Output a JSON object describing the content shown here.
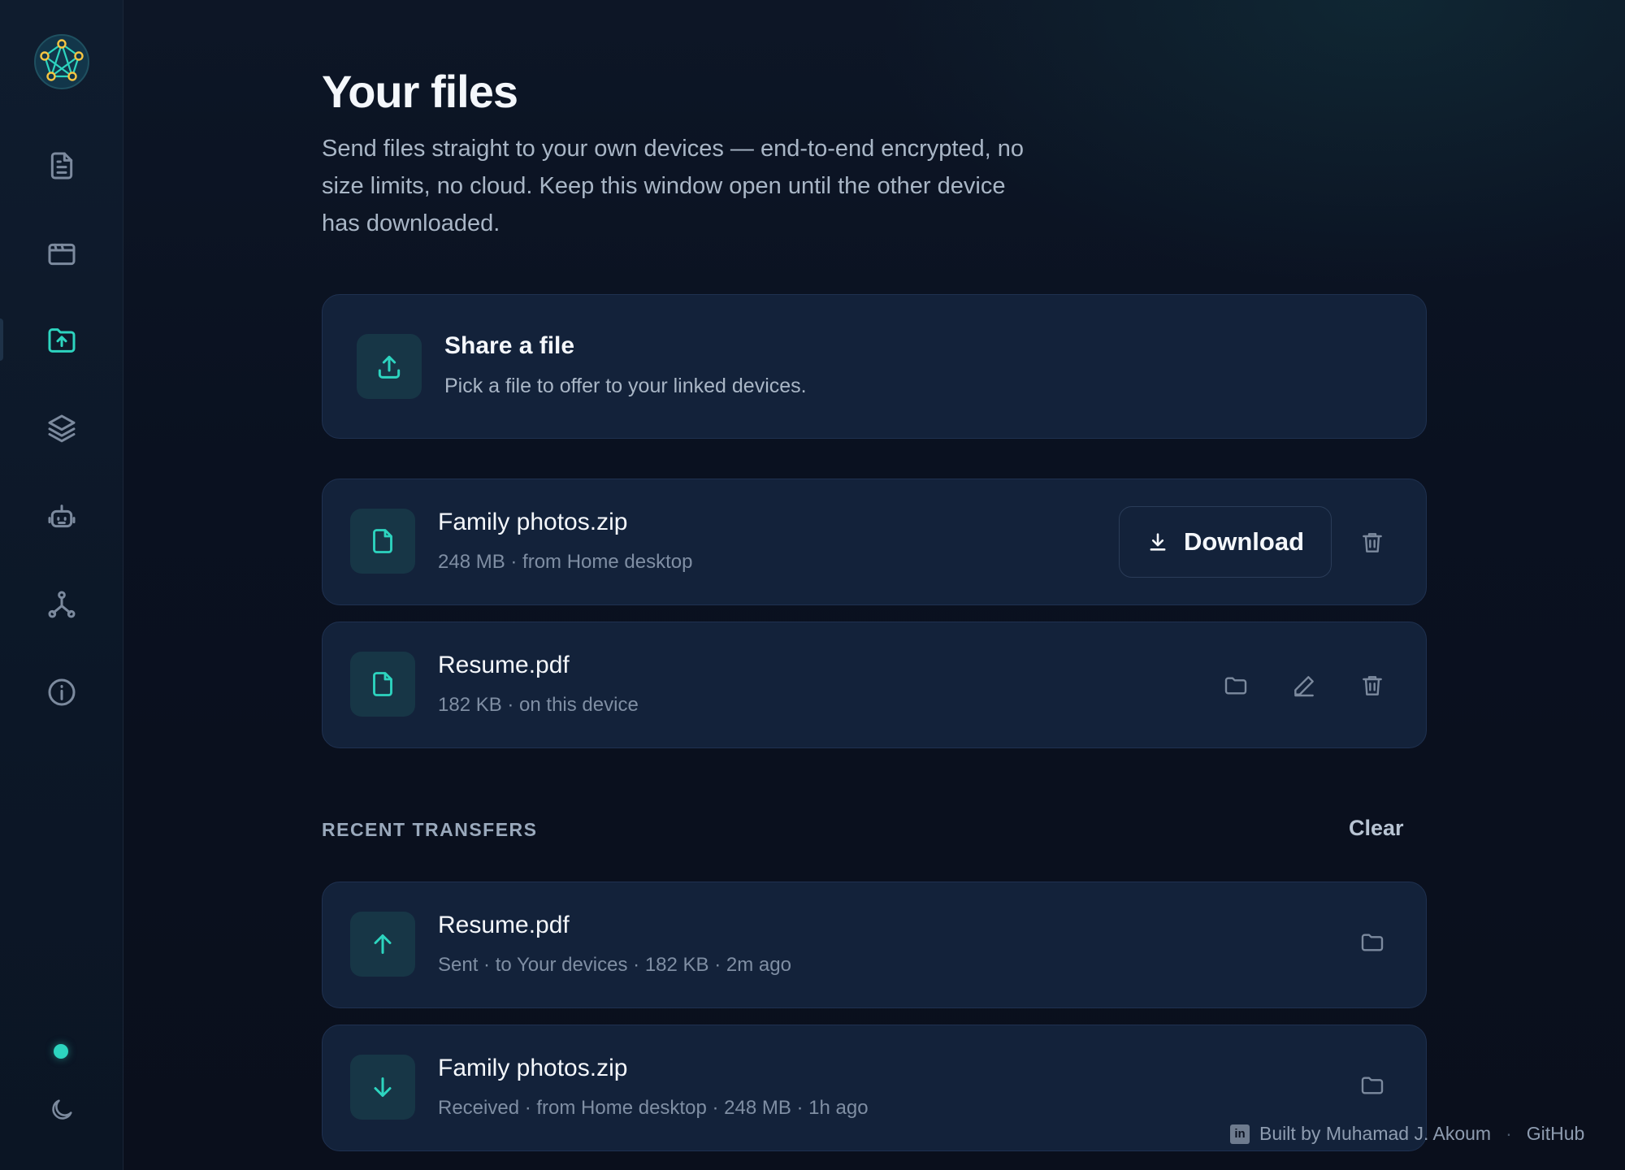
{
  "sidebar": {
    "logo_icon": "network-logo-icon",
    "items": [
      {
        "icon": "document-icon",
        "active": false
      },
      {
        "icon": "browser-window-icon",
        "active": false
      },
      {
        "icon": "file-upload-icon",
        "active": true
      },
      {
        "icon": "layers-icon",
        "active": false
      },
      {
        "icon": "robot-icon",
        "active": false
      },
      {
        "icon": "network-icon",
        "active": false
      },
      {
        "icon": "info-icon",
        "active": false
      }
    ],
    "status_color": "#2dd4bf",
    "theme_icon": "moon-icon"
  },
  "header": {
    "title": "Your files",
    "description": "Send files straight to your own devices — end-to-end encrypted, no size limits, no cloud. Keep this window open until the other device has downloaded."
  },
  "share": {
    "title": "Share a file",
    "subtitle": "Pick a file to offer to your linked devices.",
    "icon": "upload-icon"
  },
  "files": [
    {
      "name": "Family photos.zip",
      "meta": "248 MB · from Home desktop",
      "action_label": "Download"
    },
    {
      "name": "Resume.pdf",
      "meta": "182 KB · on this device"
    }
  ],
  "recent": {
    "label": "RECENT TRANSFERS",
    "clear_label": "Clear",
    "items": [
      {
        "name": "Resume.pdf",
        "meta": "Sent · to Your devices · 182 KB · 2m ago",
        "direction": "sent"
      },
      {
        "name": "Family photos.zip",
        "meta": "Received · from Home desktop · 248 MB · 1h ago",
        "direction": "received"
      }
    ]
  },
  "footer": {
    "credit": "Built by Muhamad J. Akoum",
    "separator": "·",
    "github": "GitHub",
    "linkedin_glyph": "in"
  },
  "colors": {
    "accent": "#2dd4bf",
    "card_bg": "#13223a",
    "page_bg": "#0a1120"
  }
}
